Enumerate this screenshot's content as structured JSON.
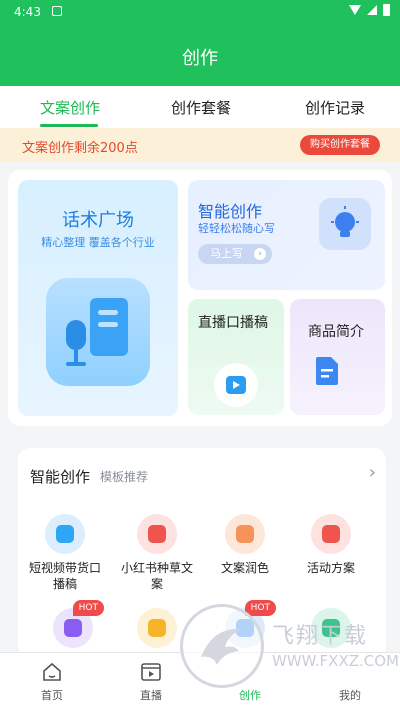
{
  "status_bar": {
    "time": "4:43"
  },
  "app_bar": {
    "title": "创作"
  },
  "tabs": [
    {
      "label": "文案创作",
      "active": true
    },
    {
      "label": "创作套餐",
      "active": false
    },
    {
      "label": "创作记录",
      "active": false
    }
  ],
  "notice": {
    "text": "文案创作剩余200点",
    "button": "购买创作套餐"
  },
  "cards": {
    "huashu": {
      "title": "话术广场",
      "subtitle": "精心整理 覆盖各个行业"
    },
    "zhineng": {
      "title": "智能创作",
      "subtitle": "轻轻松松随心写",
      "button": "马上写"
    },
    "zhibo": {
      "title": "直播口播稿"
    },
    "shangpin": {
      "title": "商品简介"
    }
  },
  "tools_section": {
    "title": "智能创作",
    "subtitle": "模板推荐",
    "items": [
      {
        "label": "短视频带货口播稿",
        "icon": "video-play-icon",
        "color": "#2fa6f5",
        "hot": false
      },
      {
        "label": "小红书种草文案",
        "icon": "heart-book-icon",
        "color": "#f0544f",
        "hot": false
      },
      {
        "label": "文案润色",
        "icon": "palette-icon",
        "color": "#f7935a",
        "hot": false
      },
      {
        "label": "活动方案",
        "icon": "gift-icon",
        "color": "#f0544f",
        "hot": false
      },
      {
        "label": "",
        "icon": "camera-icon",
        "color": "#8a5cf0",
        "hot": true
      },
      {
        "label": "",
        "icon": "pen-icon",
        "color": "#f5b42a",
        "hot": false
      },
      {
        "label": "",
        "icon": "store-icon",
        "color": "#3e8ef0",
        "hot": true
      },
      {
        "label": "",
        "icon": "cloud-icon",
        "color": "#3cc48a",
        "hot": false
      }
    ],
    "hot_label": "HOT"
  },
  "bottom_nav": [
    {
      "label": "首页",
      "icon": "home-icon",
      "active": false
    },
    {
      "label": "直播",
      "icon": "live-icon",
      "active": false
    },
    {
      "label": "创作",
      "icon": "create-icon",
      "active": true
    },
    {
      "label": "我的",
      "icon": "user-icon",
      "active": false
    }
  ],
  "watermark": {
    "cn": "飞翔下载",
    "url": "WWW.FXXZ.COM"
  },
  "colors": {
    "brand": "#20c05c",
    "accent_red": "#ea4a3c"
  }
}
